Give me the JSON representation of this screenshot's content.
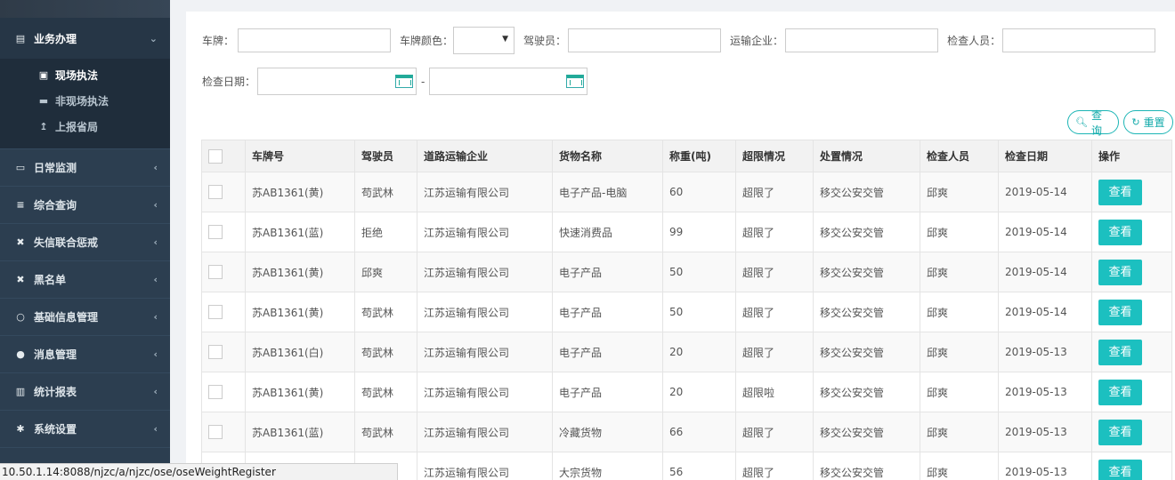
{
  "sidebar": {
    "groups": [
      {
        "label": "业务办理",
        "icon": "file-icon",
        "arrow": "⌄"
      },
      {
        "label": "日常监测",
        "icon": "monitor-icon",
        "arrow": "‹"
      },
      {
        "label": "综合查询",
        "icon": "list-icon",
        "arrow": "‹"
      },
      {
        "label": "失信联合惩戒",
        "icon": "times-icon",
        "arrow": "‹"
      },
      {
        "label": "黑名单",
        "icon": "times-icon",
        "arrow": "‹"
      },
      {
        "label": "基础信息管理",
        "icon": "circle-icon",
        "arrow": "‹"
      },
      {
        "label": "消息管理",
        "icon": "chat-icon",
        "arrow": "‹"
      },
      {
        "label": "统计报表",
        "icon": "bar-chart-icon",
        "arrow": "‹"
      },
      {
        "label": "系统设置",
        "icon": "gear-icon",
        "arrow": "‹"
      }
    ],
    "sub_items": [
      {
        "label": "现场执法",
        "icon": "bus-icon"
      },
      {
        "label": "非现场执法",
        "icon": "truck-icon"
      },
      {
        "label": "上报省局",
        "icon": "upload-icon"
      }
    ]
  },
  "filters": {
    "plate_label": "车牌：",
    "plate_value": "",
    "plate_color_label": "车牌颜色：",
    "plate_color_value": "",
    "driver_label": "驾驶员：",
    "driver_value": "",
    "company_label": "运输企业：",
    "company_value": "",
    "inspector_label": "检查人员：",
    "inspector_value": "",
    "date_label": "检查日期：",
    "date_sep": "-"
  },
  "actions": {
    "query_label": "查询",
    "reset_label": "重置"
  },
  "table": {
    "headers": [
      "车牌号",
      "驾驶员",
      "道路运输企业",
      "货物名称",
      "称重(吨)",
      "超限情况",
      "处置情况",
      "检查人员",
      "检查日期",
      "操作"
    ],
    "view_label": "查看",
    "rows": [
      [
        "苏AB1361(黄)",
        "苟武林",
        "江苏运输有限公司",
        "电子产品-电脑",
        "60",
        "超限了",
        "移交公安交管",
        "邱爽",
        "2019-05-14"
      ],
      [
        "苏AB1361(蓝)",
        "拒绝",
        "江苏运输有限公司",
        "快速消费品",
        "99",
        "超限了",
        "移交公安交管",
        "邱爽",
        "2019-05-14"
      ],
      [
        "苏AB1361(黄)",
        "邱爽",
        "江苏运输有限公司",
        "电子产品",
        "50",
        "超限了",
        "移交公安交管",
        "邱爽",
        "2019-05-14"
      ],
      [
        "苏AB1361(黄)",
        "苟武林",
        "江苏运输有限公司",
        "电子产品",
        "50",
        "超限了",
        "移交公安交管",
        "邱爽",
        "2019-05-14"
      ],
      [
        "苏AB1361(白)",
        "苟武林",
        "江苏运输有限公司",
        "电子产品",
        "20",
        "超限了",
        "移交公安交管",
        "邱爽",
        "2019-05-13"
      ],
      [
        "苏AB1361(黄)",
        "苟武林",
        "江苏运输有限公司",
        "电子产品",
        "20",
        "超限啦",
        "移交公安交管",
        "邱爽",
        "2019-05-13"
      ],
      [
        "苏AB1361(蓝)",
        "苟武林",
        "江苏运输有限公司",
        "冷藏货物",
        "66",
        "超限了",
        "移交公安交管",
        "邱爽",
        "2019-05-13"
      ],
      [
        "",
        "",
        "江苏运输有限公司",
        "大宗货物",
        "56",
        "超限了",
        "移交公安交管",
        "邱爽",
        "2019-05-13"
      ]
    ]
  },
  "statusbar": {
    "url": "10.50.1.14:8088/njzc/a/njzc/ose/oseWeightRegister"
  },
  "colors": {
    "sidebar_bg": "#2c3e50",
    "accent": "#1cc0c0"
  }
}
